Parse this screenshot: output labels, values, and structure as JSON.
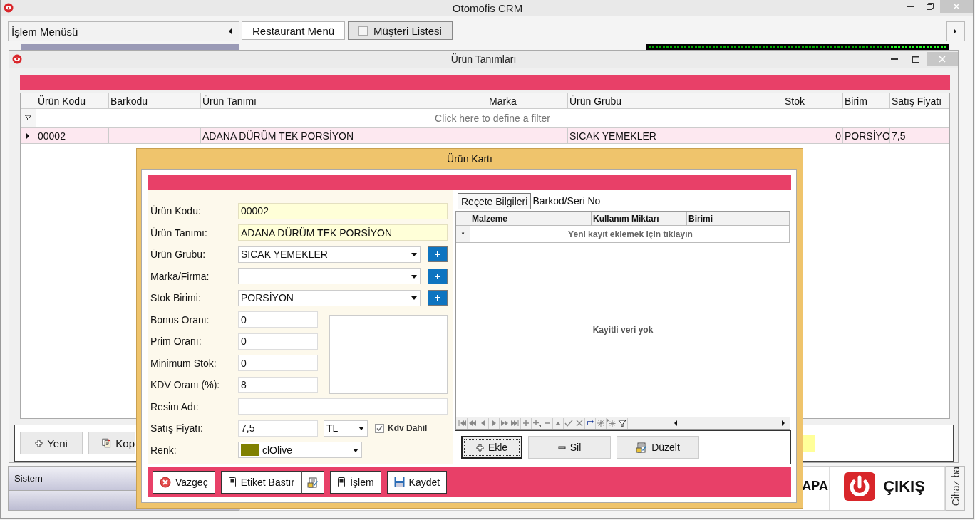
{
  "app": {
    "title": "Otomofis CRM"
  },
  "menu_panel": {
    "title": "İşlem Menüsü"
  },
  "tabs": [
    {
      "label": "Restaurant Menü",
      "selected": true,
      "kind": "plain"
    },
    {
      "label": "Müşteri Listesi",
      "selected": false,
      "kind": "checkbox"
    }
  ],
  "products_window": {
    "title": "Ürün Tanımları",
    "columns": [
      "Ürün Kodu",
      "Barkodu",
      "Ürün Tanımı",
      "Marka",
      "Ürün Grubu",
      "Stok",
      "Birim",
      "Satış Fiyatı"
    ],
    "filter_hint": "Click here to define a filter",
    "rows": [
      {
        "cells": [
          "00002",
          null,
          "ADANA DÜRÜM TEK PORSİYON",
          null,
          "SICAK YEMEKLER",
          "0",
          "PORSİYO",
          "7,5"
        ],
        "selected": true
      }
    ],
    "buttons": [
      "Yeni",
      "Kop"
    ]
  },
  "sidebar": {
    "title": "Sistem"
  },
  "bottom_bar": {
    "tiles": [
      "APA",
      "ÇIKIŞ"
    ],
    "side_label": "Cihaz ba"
  },
  "product_card": {
    "title": "Ürün Kartı",
    "fields": [
      {
        "label": "Ürün Kodu:",
        "kind": "text",
        "value": "00002",
        "highlighted": true
      },
      {
        "label": "Ürün Tanımı:",
        "kind": "text",
        "value": "ADANA DÜRÜM TEK PORSİYON",
        "highlighted": true
      },
      {
        "label": "Ürün Grubu:",
        "kind": "combo",
        "value": "SICAK YEMEKLER",
        "highlighted": false
      },
      {
        "label": "Marka/Firma:",
        "kind": "combo",
        "highlighted": false
      },
      {
        "label": "Stok Birimi:",
        "kind": "combo",
        "value": "PORSİYON",
        "highlighted": false
      },
      {
        "label": "Bonus Oranı:",
        "kind": "short",
        "value": "0",
        "highlighted": false
      },
      {
        "label": "Prim Oranı:",
        "kind": "short",
        "value": "0",
        "highlighted": false
      },
      {
        "label": "Minimum Stok:",
        "kind": "short",
        "value": "0",
        "highlighted": false
      },
      {
        "label": "KDV Oranı (%):",
        "kind": "short",
        "value": "8",
        "highlighted": false
      },
      {
        "label": "Resim Adı:",
        "kind": "text",
        "highlighted": false
      },
      {
        "label": "Satış Fiyatı:",
        "kind": "price",
        "value": "7,5",
        "highlighted": false,
        "currency": "TL",
        "vat_label": "Kdv Dahil",
        "vat_checked": true
      },
      {
        "label": "Renk:",
        "kind": "color",
        "value": "clOlive",
        "color": "#808000",
        "highlighted": false
      }
    ],
    "tabs": [
      {
        "label": "Reçete Bilgileri",
        "selected": true
      },
      {
        "label": "Barkod/Seri No",
        "selected": false
      }
    ],
    "recipe_grid": {
      "columns": [
        "Malzeme",
        "Kullanım Miktarı",
        "Birimi"
      ],
      "new_row_marker": "*",
      "new_row_hint": "Yeni kayıt eklemek için tıklayın",
      "empty_text": "Kayitli veri yok"
    },
    "recipe_buttons": [
      {
        "label": "Ekle",
        "focused": true
      },
      {
        "label": "Sil",
        "focused": false
      },
      {
        "label": "Düzelt",
        "focused": false
      }
    ],
    "footer_buttons": [
      {
        "label": "Vazgeç",
        "split": false
      },
      {
        "label": "Etiket Bastır",
        "split": true
      },
      {
        "label": "İşlem",
        "split": false
      },
      {
        "label": "Kaydet",
        "split": false
      }
    ]
  }
}
